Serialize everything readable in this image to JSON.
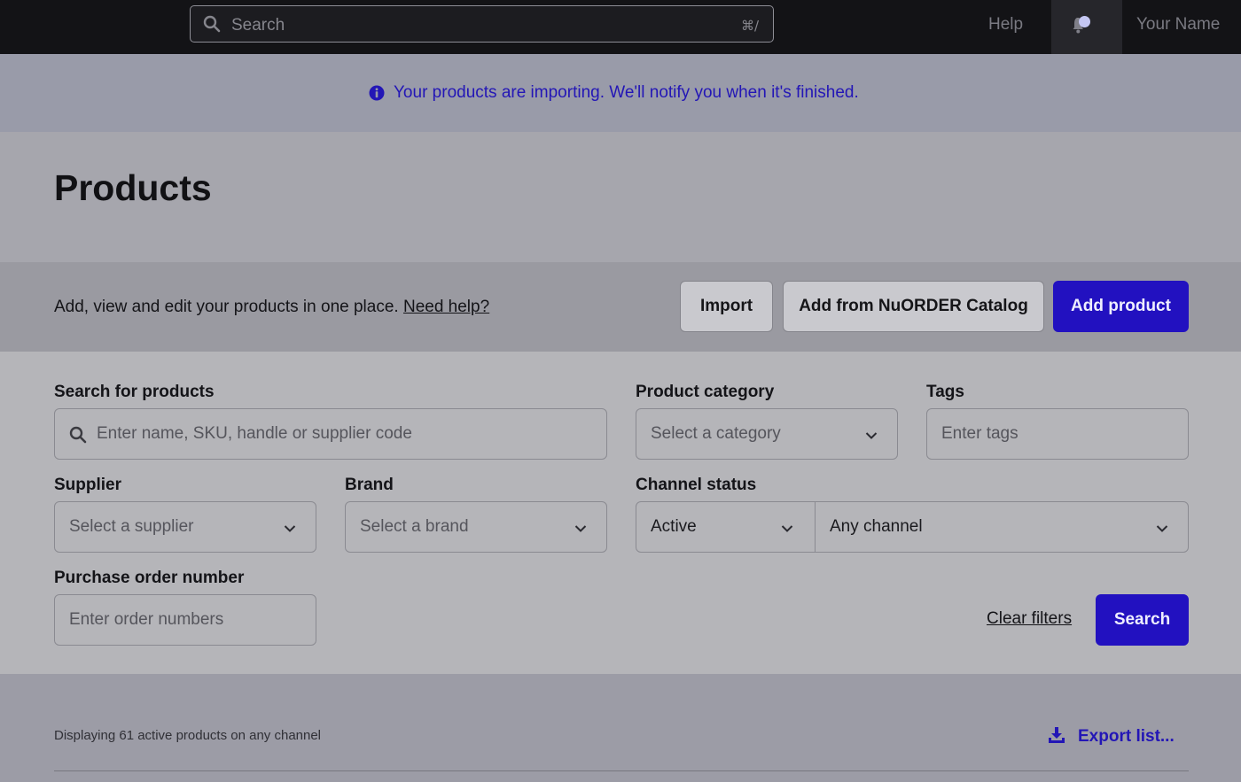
{
  "topbar": {
    "search_placeholder": "Search",
    "search_shortcut": "⌘/",
    "help_label": "Help",
    "user_name": "Your Name",
    "notifications_icon": "bell-icon"
  },
  "banner": {
    "message": "Your products are importing. We'll notify you when it's finished.",
    "icon": "info-icon"
  },
  "page": {
    "title": "Products",
    "description": "Add, view and edit your products in one place.",
    "help_link": "Need help?"
  },
  "actions": {
    "import": "Import",
    "add_from_catalog": "Add from NuORDER Catalog",
    "add_product": "Add product"
  },
  "filters": {
    "search_label": "Search for products",
    "search_placeholder": "Enter name, SKU, handle or supplier code",
    "category_label": "Product category",
    "category_placeholder": "Select a category",
    "tags_label": "Tags",
    "tags_placeholder": "Enter tags",
    "supplier_label": "Supplier",
    "supplier_placeholder": "Select a supplier",
    "brand_label": "Brand",
    "brand_placeholder": "Select a brand",
    "channel_status_label": "Channel status",
    "status_value": "Active",
    "channel_value": "Any channel",
    "po_label": "Purchase order number",
    "po_placeholder": "Enter order numbers",
    "clear_label": "Clear filters",
    "search_button": "Search"
  },
  "results": {
    "summary": "Displaying 61 active products on any channel",
    "export_label": "Export list..."
  },
  "colors": {
    "accent": "#2211c0",
    "banner_text": "#2316b6",
    "topbar": "#131316"
  }
}
